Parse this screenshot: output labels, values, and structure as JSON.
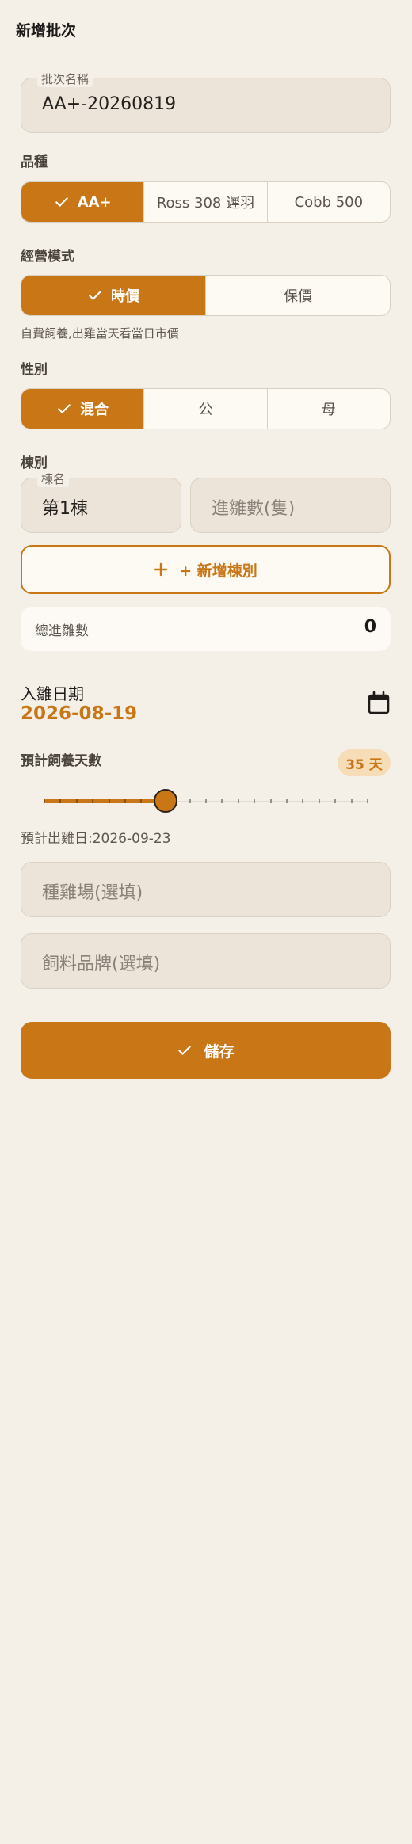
{
  "header": {
    "title": "新增批次"
  },
  "batch_name": {
    "label": "批次名稱",
    "value": "AA+-20260819"
  },
  "breed": {
    "label": "品種",
    "options": [
      "AA+",
      "Ross 308 遲羽",
      "Cobb 500"
    ],
    "selected": "AA+"
  },
  "mode": {
    "label": "經營模式",
    "options": [
      "時價",
      "保價"
    ],
    "selected": "時價",
    "hint": "自費飼養,出雞當天看當日市價"
  },
  "sex": {
    "label": "性別",
    "options": [
      "混合",
      "公",
      "母"
    ],
    "selected": "混合"
  },
  "house": {
    "label": "棟別",
    "name_label": "棟名",
    "name_value": "第1棟",
    "count_placeholder": "進雛數(隻)",
    "add_label": "+ 新增棟別"
  },
  "total": {
    "label": "總進雛數",
    "value": "0"
  },
  "chick_date": {
    "label": "入雛日期",
    "value": "2026-08-19"
  },
  "raise_days": {
    "label": "預計飼養天數",
    "badge": "35 天",
    "value": 35,
    "min": 20,
    "max": 60
  },
  "out_date": {
    "text": "預計出雞日:2026-09-23"
  },
  "hatchery": {
    "placeholder": "種雞場(選填)"
  },
  "feed_brand": {
    "placeholder": "飼料品牌(選填)"
  },
  "save": {
    "label": "儲存"
  },
  "colors": {
    "accent": "#c97616",
    "background": "#f4efe7",
    "field": "#ece4d8"
  },
  "icons": {
    "check": "check-icon",
    "plus": "plus-icon",
    "calendar": "calendar-icon"
  }
}
